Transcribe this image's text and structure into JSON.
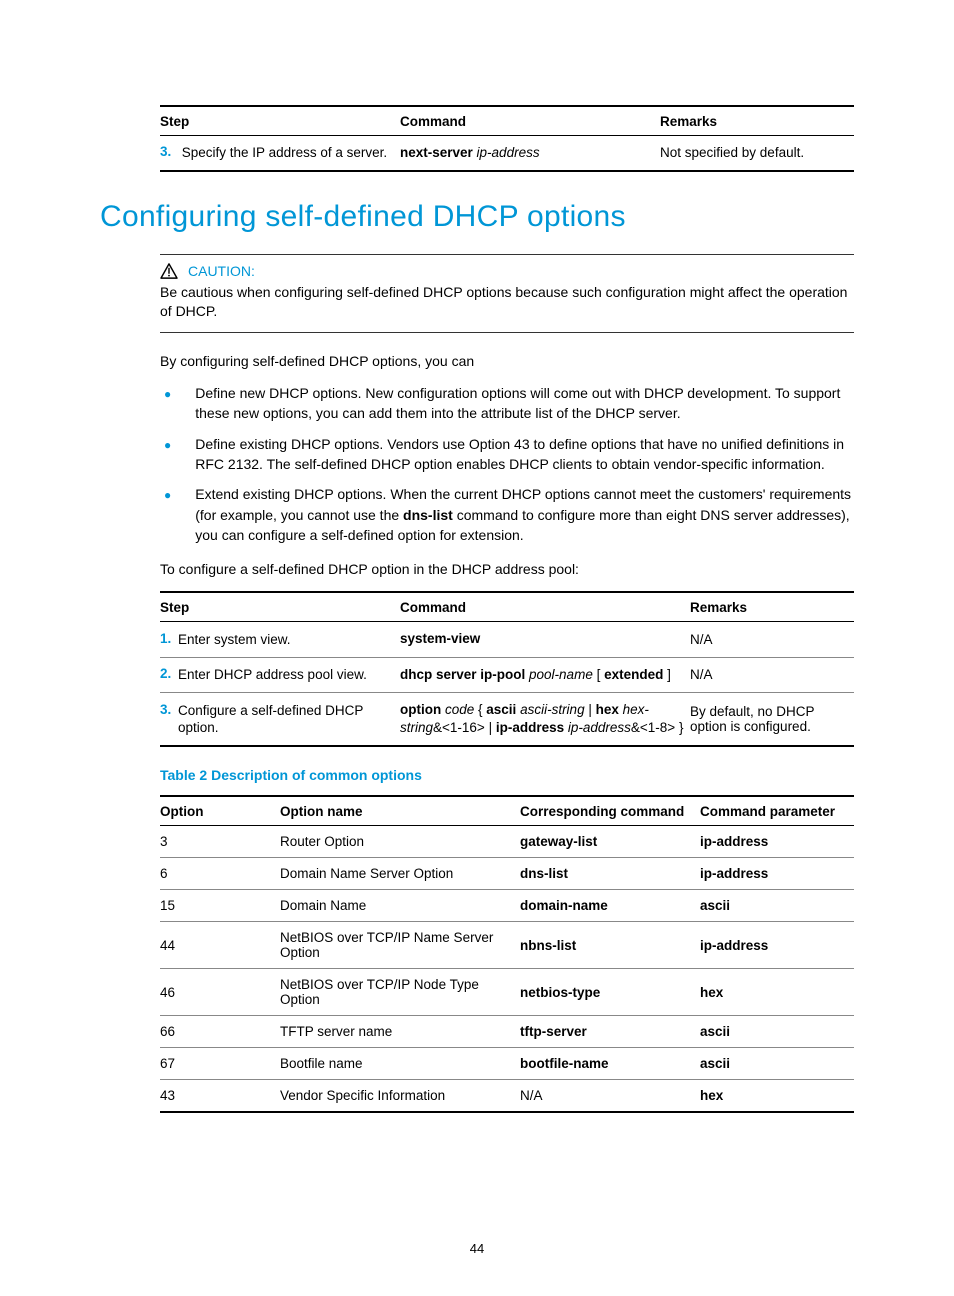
{
  "topTable": {
    "headers": [
      "Step",
      "Command",
      "Remarks"
    ],
    "row": {
      "num": "3.",
      "desc": "Specify the IP address of a server.",
      "cmd_bold": "next-server",
      "cmd_ital": " ip-address",
      "remarks": "Not specified by default."
    }
  },
  "heading": "Configuring self-defined DHCP options",
  "caution": {
    "label": "CAUTION:",
    "text": "Be cautious when configuring self-defined DHCP options because such configuration might affect the operation of DHCP."
  },
  "intro": "By configuring self-defined DHCP options, you can",
  "bullets": [
    "Define new DHCP options. New configuration options will come out with DHCP development. To support these new options, you can add them into the attribute list of the DHCP server.",
    "Define existing DHCP options. Vendors use Option 43 to define options that have no unified definitions in RFC 2132. The self-defined DHCP option enables DHCP clients to obtain vendor-specific information.",
    {
      "before": "Extend existing DHCP options. When the current DHCP options cannot meet the customers' requirements (for example, you cannot use the ",
      "bold": "dns-list",
      "after": " command to configure more than eight DNS server addresses), you can configure a self-defined option for extension."
    }
  ],
  "configLine": "To configure a self-defined DHCP option in the DHCP address pool:",
  "stepTable": {
    "headers": [
      "Step",
      "Command",
      "Remarks"
    ],
    "rows": [
      {
        "num": "1.",
        "desc": "Enter system view.",
        "cmd": [
          {
            "b": "system-view"
          }
        ],
        "remarks": "N/A"
      },
      {
        "num": "2.",
        "desc": "Enter DHCP address pool view.",
        "cmd": [
          {
            "b": "dhcp server ip-pool"
          },
          {
            "i": " pool-name"
          },
          {
            "t": " [ "
          },
          {
            "b": "extended"
          },
          {
            "t": " ]"
          }
        ],
        "remarks": "N/A"
      },
      {
        "num": "3.",
        "desc": "Configure a self-defined DHCP option.",
        "cmd": [
          {
            "b": "option"
          },
          {
            "i": " code"
          },
          {
            "t": " { "
          },
          {
            "b": "ascii"
          },
          {
            "i": " ascii-string"
          },
          {
            "t": " | "
          },
          {
            "b": "hex"
          },
          {
            "i": " hex-string"
          },
          {
            "t": "&<1-16>"
          },
          {
            "t": " | "
          },
          {
            "b": "ip-address"
          },
          {
            "i": " ip-address"
          },
          {
            "t": "&<1-8> }"
          }
        ],
        "remarks": "By default, no DHCP option is configured."
      }
    ]
  },
  "table2": {
    "caption": "Table 2 Description of common options",
    "headers": [
      "Option",
      "Option name",
      "Corresponding command",
      "Command parameter"
    ],
    "rows": [
      {
        "o": "3",
        "n": "Router Option",
        "c": "gateway-list",
        "p": "ip-address",
        "na": false
      },
      {
        "o": "6",
        "n": "Domain Name Server Option",
        "c": "dns-list",
        "p": "ip-address",
        "na": false
      },
      {
        "o": "15",
        "n": "Domain Name",
        "c": "domain-name",
        "p": "ascii",
        "na": false
      },
      {
        "o": "44",
        "n": "NetBIOS over TCP/IP Name Server Option",
        "c": "nbns-list",
        "p": "ip-address",
        "na": false
      },
      {
        "o": "46",
        "n": "NetBIOS over TCP/IP Node Type Option",
        "c": "netbios-type",
        "p": "hex",
        "na": false
      },
      {
        "o": "66",
        "n": "TFTP server name",
        "c": "tftp-server",
        "p": "ascii",
        "na": false
      },
      {
        "o": "67",
        "n": "Bootfile name",
        "c": "bootfile-name",
        "p": "ascii",
        "na": false
      },
      {
        "o": "43",
        "n": "Vendor Specific Information",
        "c": "N/A",
        "p": "hex",
        "na": true
      }
    ]
  },
  "pageNumber": "44"
}
